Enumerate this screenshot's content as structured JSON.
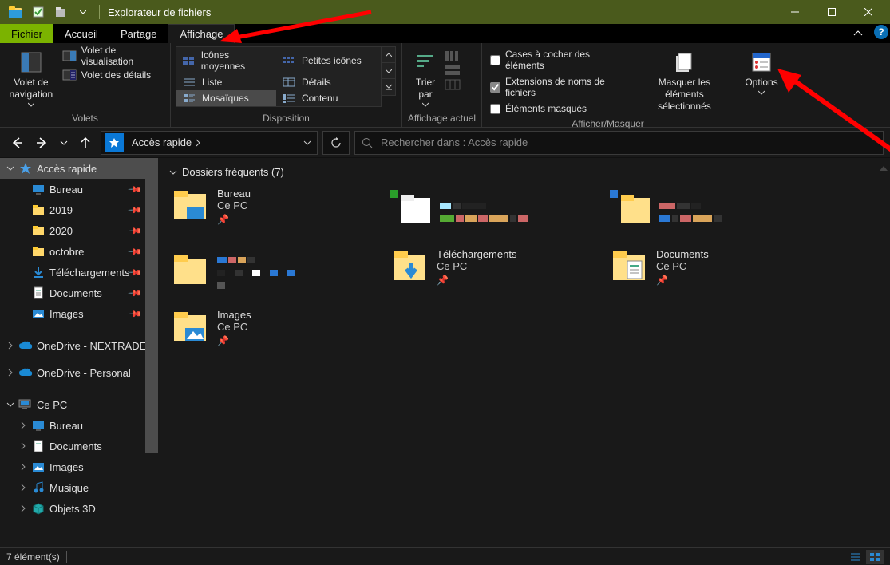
{
  "titlebar": {
    "title": "Explorateur de fichiers"
  },
  "tabs": {
    "file": "Fichier",
    "home": "Accueil",
    "share": "Partage",
    "view": "Affichage"
  },
  "ribbon": {
    "panes": {
      "navigation_pane": "Volet de\nnavigation",
      "preview_pane": "Volet de visualisation",
      "details_pane": "Volet des détails",
      "group_label": "Volets"
    },
    "layout": {
      "medium_icons": "Icônes moyennes",
      "small_icons": "Petites icônes",
      "list": "Liste",
      "details": "Détails",
      "tiles": "Mosaïques",
      "content": "Contenu",
      "group_label": "Disposition"
    },
    "current_view": {
      "sort_by": "Trier\npar",
      "group_label": "Affichage actuel"
    },
    "show_hide": {
      "checkboxes": "Cases à cocher des éléments",
      "extensions": "Extensions de noms de fichiers",
      "hidden": "Éléments masqués",
      "hide_selected": "Masquer les éléments\nsélectionnés",
      "group_label": "Afficher/Masquer"
    },
    "options": {
      "label": "Options"
    }
  },
  "nav": {
    "breadcrumb": "Accès rapide",
    "search_placeholder": "Rechercher dans : Accès rapide"
  },
  "tree": {
    "quick_access": "Accès rapide",
    "desktop": "Bureau",
    "y2019": "2019",
    "y2020": "2020",
    "october": "octobre",
    "downloads": "Téléchargements",
    "documents": "Documents",
    "images": "Images",
    "onedrive_biz": "OneDrive - NEXTRADE",
    "onedrive_personal": "OneDrive - Personal",
    "this_pc": "Ce PC",
    "pc_desktop": "Bureau",
    "pc_documents": "Documents",
    "pc_images": "Images",
    "pc_music": "Musique",
    "pc_3d": "Objets 3D"
  },
  "main": {
    "group_header": "Dossiers fréquents (7)",
    "tiles": [
      {
        "name": "Bureau",
        "sub": "Ce PC",
        "icon": "desktop",
        "pinned": true
      },
      {
        "name": "",
        "sub": "",
        "icon": "folder",
        "pinned": false,
        "censored": true
      },
      {
        "name": "",
        "sub": "",
        "icon": "folder",
        "pinned": false,
        "censored": true
      },
      {
        "name": "",
        "sub": "",
        "icon": "folder",
        "pinned": false,
        "censored": true
      },
      {
        "name": "Téléchargements",
        "sub": "Ce PC",
        "icon": "downloads",
        "pinned": true
      },
      {
        "name": "Documents",
        "sub": "Ce PC",
        "icon": "documents",
        "pinned": true
      },
      {
        "name": "Images",
        "sub": "Ce PC",
        "icon": "images",
        "pinned": true
      }
    ]
  },
  "status": {
    "items": "7 élément(s)"
  }
}
